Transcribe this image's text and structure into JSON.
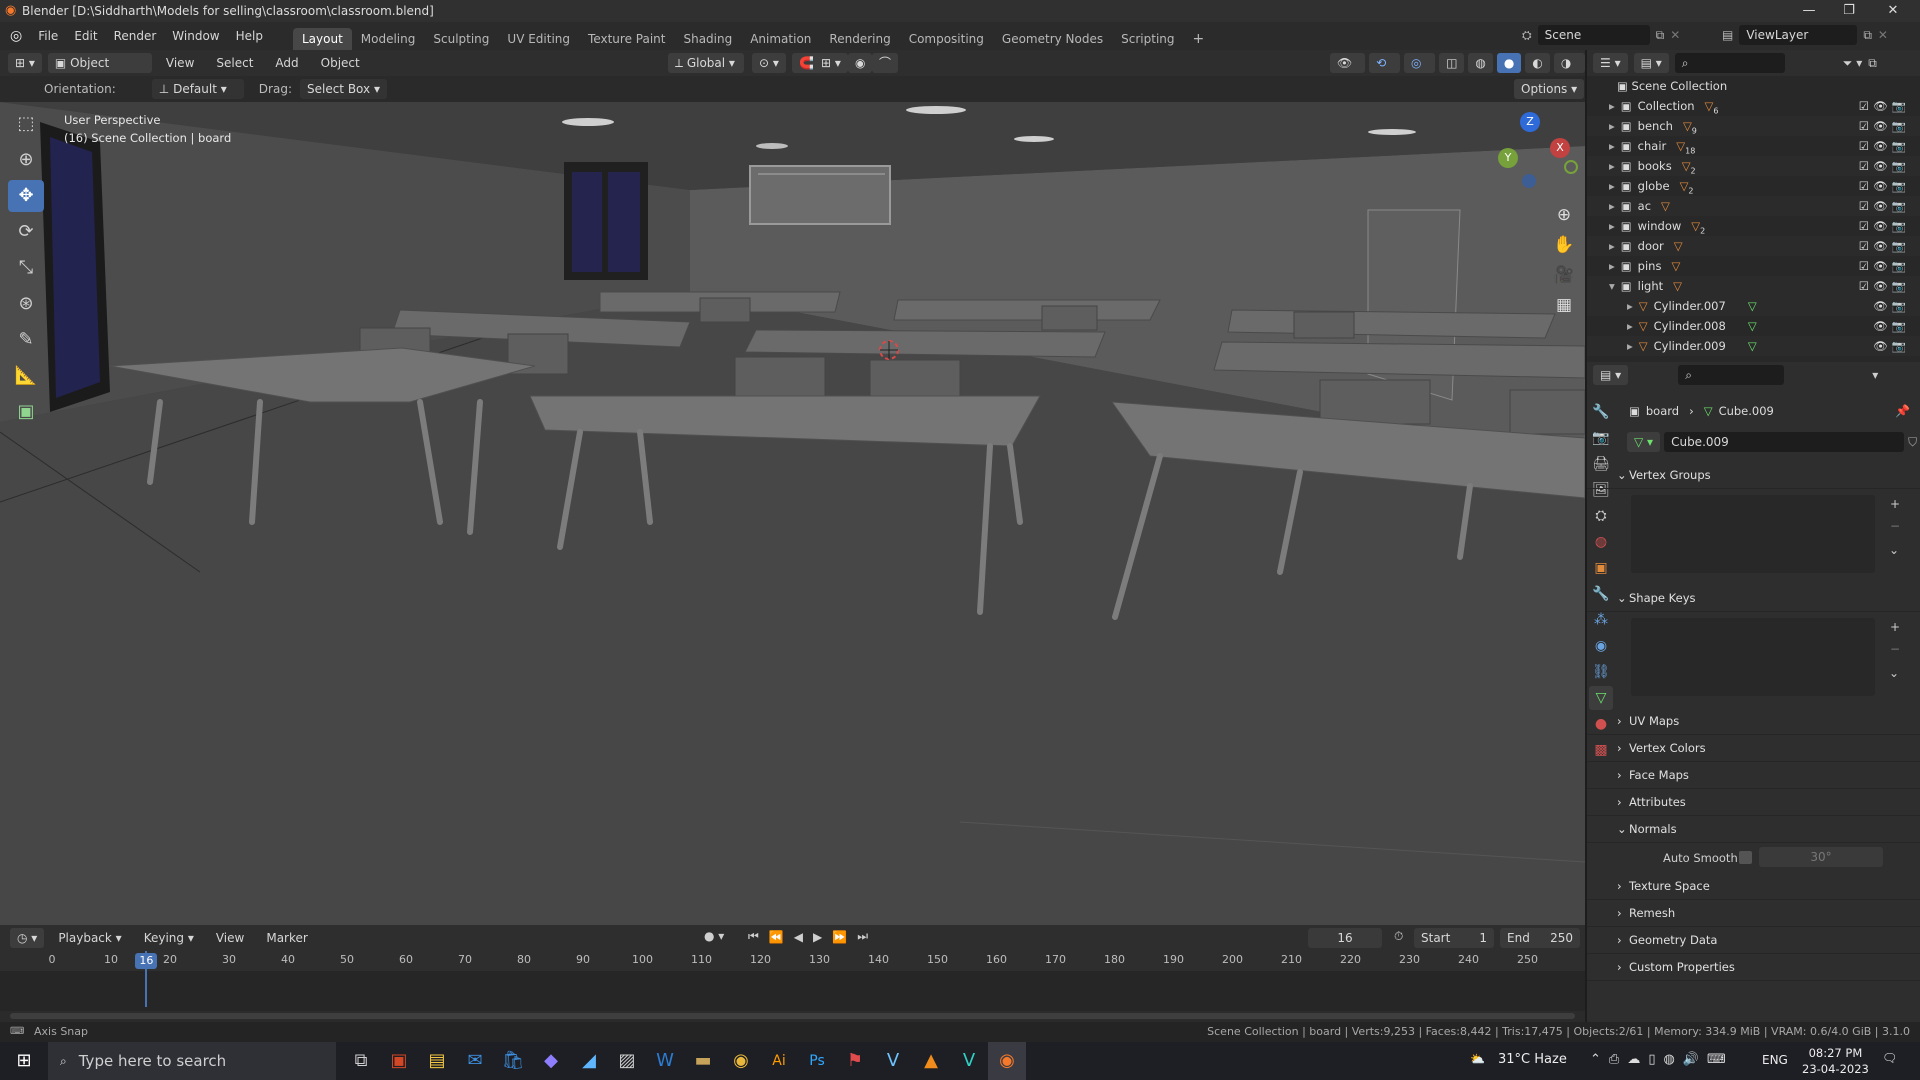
{
  "window": {
    "title": "Blender [D:\\Siddharth\\Models for selling\\classroom\\classroom.blend]",
    "min": "—",
    "max": "❐",
    "close": "✕"
  },
  "menu": [
    "File",
    "Edit",
    "Render",
    "Window",
    "Help"
  ],
  "workspaces": [
    "Layout",
    "Modeling",
    "Sculpting",
    "UV Editing",
    "Texture Paint",
    "Shading",
    "Animation",
    "Rendering",
    "Compositing",
    "Geometry Nodes",
    "Scripting"
  ],
  "active_workspace": "Layout",
  "scene": "Scene",
  "view_layer": "ViewLayer",
  "header": {
    "mode": "Object Mode",
    "view": "View",
    "select": "Select",
    "add": "Add",
    "object": "Object",
    "transform": "Global",
    "options": "Options"
  },
  "tool_settings": {
    "orientation_label": "Orientation:",
    "orientation": "Default",
    "drag_label": "Drag:",
    "drag": "Select Box"
  },
  "viewport": {
    "view_name": "User Perspective",
    "collection_info": "(16) Scene Collection | board"
  },
  "gizmo": {
    "x": "X",
    "y": "Y",
    "z": "Z"
  },
  "outliner": {
    "root": "Scene Collection",
    "items": [
      {
        "name": "Collection",
        "count": "6"
      },
      {
        "name": "bench",
        "count": "9"
      },
      {
        "name": "chair",
        "count": "18"
      },
      {
        "name": "books",
        "count": "2"
      },
      {
        "name": "globe",
        "count": "2"
      },
      {
        "name": "ac",
        "count": ""
      },
      {
        "name": "window",
        "count": "2"
      },
      {
        "name": "door",
        "count": ""
      },
      {
        "name": "pins",
        "count": ""
      },
      {
        "name": "light",
        "count": ""
      }
    ],
    "children": [
      "Cylinder.007",
      "Cylinder.008",
      "Cylinder.009"
    ]
  },
  "properties": {
    "breadcrumb_object": "board",
    "breadcrumb_data": "Cube.009",
    "data_name": "Cube.009",
    "sections": [
      "Vertex Groups",
      "Shape Keys",
      "UV Maps",
      "Vertex Colors",
      "Face Maps",
      "Attributes",
      "Normals",
      "Texture Space",
      "Remesh",
      "Geometry Data",
      "Custom Properties"
    ],
    "auto_smooth_label": "Auto Smooth",
    "auto_smooth_angle": "30°"
  },
  "timeline": {
    "playback": "Playback",
    "keying": "Keying",
    "view": "View",
    "marker": "Marker",
    "current_frame": "16",
    "start_label": "Start",
    "start": "1",
    "end_label": "End",
    "end": "250",
    "ticks": [
      "0",
      "10",
      "20",
      "30",
      "40",
      "50",
      "60",
      "70",
      "80",
      "90",
      "100",
      "110",
      "120",
      "130",
      "140",
      "150",
      "160",
      "170",
      "180",
      "190",
      "200",
      "210",
      "220",
      "230",
      "240",
      "250"
    ],
    "cursor_label": "16"
  },
  "status": {
    "left": "Axis Snap",
    "right": "Scene Collection | board | Verts:9,253 | Faces:8,442 | Tris:17,475 | Objects:2/61 | Memory: 334.9 MiB | VRAM: 0.6/4.0 GiB | 3.1.0"
  },
  "taskbar": {
    "search_placeholder": "Type here to search",
    "weather": "31°C  Haze",
    "lang": "ENG",
    "time": "08:27 PM",
    "date": "23-04-2023"
  }
}
